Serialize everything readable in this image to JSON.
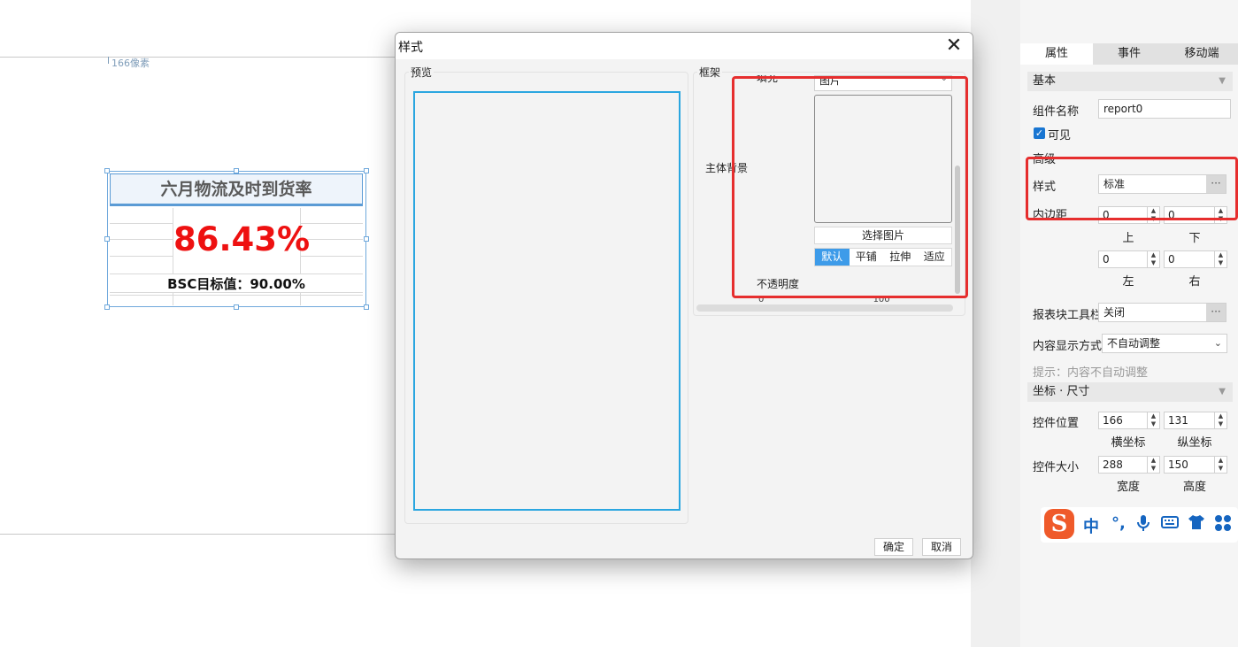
{
  "canvas": {
    "ruler_label": "166像素",
    "report": {
      "title": "六月物流及时到货率",
      "value": "86.43%",
      "target": "BSC目标值：90.00%"
    }
  },
  "sidebar": {
    "tabs": [
      "属性",
      "事件",
      "移动端"
    ],
    "basic_section": "基本",
    "component_name_label": "组件名称",
    "component_name_value": "report0",
    "visible_label": "可见",
    "advanced_section": "高级",
    "style_label": "样式",
    "style_value": "标准",
    "dots": "···",
    "padding_label": "内边距",
    "padding": {
      "top": "0",
      "bottom": "0",
      "left": "0",
      "right": "0",
      "top_label": "上",
      "bottom_label": "下",
      "left_label": "左",
      "right_label": "右"
    },
    "toolbar_label": "报表块工具栏",
    "toolbar_value": "关闭",
    "display_mode_label": "内容显示方式",
    "display_mode_value": "不自动调整",
    "hint": "提示：内容不自动调整",
    "coord_section": "坐标 · 尺寸",
    "position_label": "控件位置",
    "position_x": "166",
    "position_y": "131",
    "x_label": "横坐标",
    "y_label": "纵坐标",
    "size_label": "控件大小",
    "width": "288",
    "height": "150",
    "width_label": "宽度",
    "height_label": "高度"
  },
  "ime": {
    "logo": "S",
    "items": [
      "中",
      "•,",
      "mic-icon",
      "keyboard-icon",
      "shirt-icon",
      "apps-icon"
    ],
    "lang": "中",
    "punct": "°,"
  },
  "dialog": {
    "title": "样式",
    "close": "✕",
    "preview_label": "预览",
    "frame_label": "框架",
    "fill_label": "填充",
    "fill_value": "图片",
    "body_bg_label": "主体背景",
    "choose_image": "选择图片",
    "modes": [
      "默认",
      "平铺",
      "拉伸",
      "适应"
    ],
    "active_mode": "默认",
    "opacity_label": "不透明度",
    "slider_min": "0",
    "slider_max": "100",
    "confirm": "确定",
    "cancel": "取消"
  },
  "colors": {
    "highlight": "#e62e2e",
    "accent": "#3d9be9",
    "value_red": "#ee1111"
  }
}
